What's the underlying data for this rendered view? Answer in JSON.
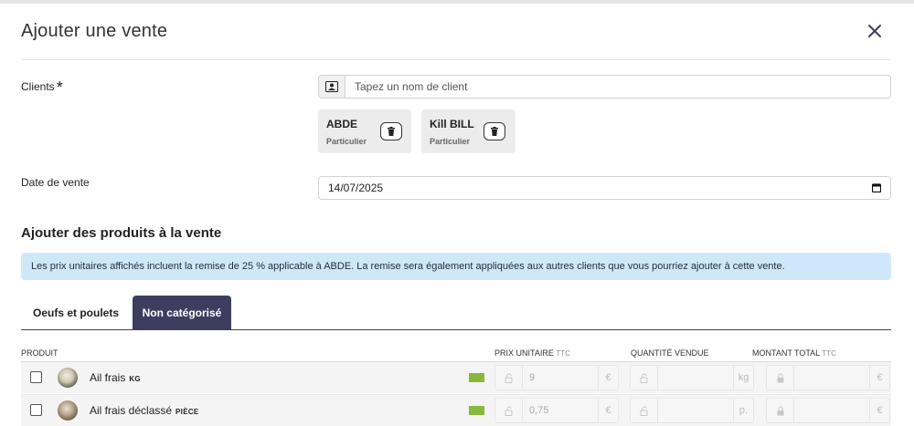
{
  "modal": {
    "title": "Ajouter une vente"
  },
  "clients": {
    "label": "Clients",
    "required_mark": "*",
    "search_placeholder": "Tapez un nom de client",
    "search_value": "",
    "selected": [
      {
        "name": "ABDE",
        "type": "Particulier"
      },
      {
        "name": "Kill BILL",
        "type": "Particulier"
      }
    ]
  },
  "sale_date": {
    "label": "Date de vente",
    "value": "14/07/2025"
  },
  "products_section": {
    "title": "Ajouter des produits à la vente",
    "info": "Les prix unitaires affichés incluent la remise de 25 % applicable à ABDE. La remise sera également appliquées aux autres clients que vous pourriez ajouter à cette vente."
  },
  "tabs": [
    {
      "label": "Oeufs et poulets",
      "active": false
    },
    {
      "label": "Non catégorisé",
      "active": true
    }
  ],
  "table": {
    "col_product": "PRODUIT",
    "col_unit_price": "PRIX UNITAIRE",
    "col_quantity": "QUANTITÉ VENDUE",
    "col_total": "MONTANT TOTAL",
    "ttc": "TTC",
    "rows": [
      {
        "name": "Ail frais",
        "unit": "KG",
        "price": "9",
        "price_suffix": "€",
        "qty": "",
        "qty_suffix": "kg",
        "total": "",
        "total_suffix": "€"
      },
      {
        "name": "Ail frais déclassé",
        "unit": "PIÈCE",
        "price": "0,75",
        "price_suffix": "€",
        "qty": "",
        "qty_suffix": "p.",
        "total": "",
        "total_suffix": "€"
      }
    ]
  },
  "colors": {
    "accent": "#3d3e5f",
    "info_bg": "#cfe8f9",
    "organic_flag": "#88b83a"
  },
  "icons": {
    "close": "close-icon",
    "contact": "contact-card-icon",
    "trash": "trash-icon",
    "calendar": "calendar-icon",
    "lock": "lock-icon",
    "unlock": "unlock-icon"
  }
}
